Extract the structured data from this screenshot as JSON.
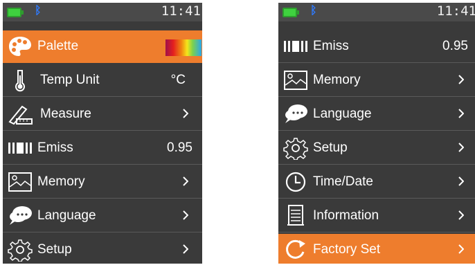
{
  "left": {
    "clock": "11:41",
    "items": [
      {
        "label": "Palette",
        "value": ""
      },
      {
        "label": "Temp Unit",
        "value": "°C"
      },
      {
        "label": "Measure",
        "value": ""
      },
      {
        "label": "Emiss",
        "value": "0.95"
      },
      {
        "label": "Memory",
        "value": ""
      },
      {
        "label": "Language",
        "value": ""
      },
      {
        "label": "Setup",
        "value": ""
      }
    ]
  },
  "right": {
    "clock": "11:41",
    "items": [
      {
        "label": "Emiss",
        "value": "0.95"
      },
      {
        "label": "Memory",
        "value": ""
      },
      {
        "label": "Language",
        "value": ""
      },
      {
        "label": "Setup",
        "value": ""
      },
      {
        "label": "Time/Date",
        "value": ""
      },
      {
        "label": "Information",
        "value": ""
      },
      {
        "label": "Factory Set",
        "value": ""
      }
    ]
  },
  "colors": {
    "highlight": "#ee7d2d",
    "background": "#3a3a3a",
    "battery": "#3fd13f",
    "bluetooth": "#2f7bff"
  },
  "icons": [
    "palette-icon",
    "thermometer-icon",
    "ruler-pencil-icon",
    "emissivity-icon",
    "memory-image-icon",
    "chat-bubble-icon",
    "gear-icon",
    "clock-icon",
    "document-icon",
    "reset-icon",
    "chevron-right-icon",
    "bluetooth-icon",
    "battery-icon"
  ]
}
